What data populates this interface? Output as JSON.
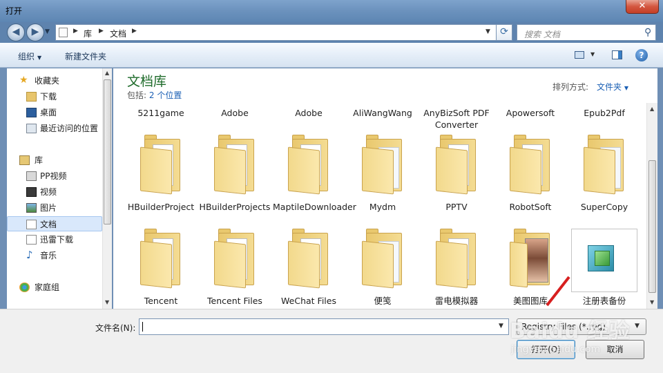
{
  "window": {
    "title": "打开",
    "close_label": "✕"
  },
  "nav": {
    "back_glyph": "◀",
    "forward_glyph": "▶",
    "breadcrumb": [
      "库",
      "文档"
    ],
    "search_placeholder": "搜索 文档",
    "refresh_glyph": "⟳"
  },
  "toolbar": {
    "organize_label": "组织",
    "new_folder_label": "新建文件夹",
    "help_glyph": "?"
  },
  "sidebar": {
    "items": [
      {
        "label": "收藏夹",
        "icon": "star-icon"
      },
      {
        "label": "下载",
        "icon": "download-folder-icon"
      },
      {
        "label": "桌面",
        "icon": "desktop-icon"
      },
      {
        "label": "最近访问的位置",
        "icon": "recent-places-icon"
      },
      {
        "label": "库",
        "icon": "library-icon"
      },
      {
        "label": "PP视频",
        "icon": "video-library-icon"
      },
      {
        "label": "视频",
        "icon": "video-icon"
      },
      {
        "label": "图片",
        "icon": "pictures-icon"
      },
      {
        "label": "文档",
        "icon": "documents-icon",
        "selected": true
      },
      {
        "label": "迅雷下载",
        "icon": "thunder-download-icon"
      },
      {
        "label": "音乐",
        "icon": "music-icon"
      },
      {
        "label": "家庭组",
        "icon": "homegroup-icon"
      }
    ]
  },
  "library": {
    "title": "文档库",
    "includes_label": "包括:",
    "locations_link": "2 个位置",
    "arrange_label": "排列方式:",
    "arrange_value": "文件夹"
  },
  "files": {
    "top_row": [
      "5211game",
      "Adobe",
      "Adobe",
      "AliWangWang",
      "AnyBizSoft PDF Converter",
      "Apowersoft",
      "Epub2Pdf"
    ],
    "row2": [
      "HBuilderProject",
      "HBuilderProjects",
      "MaptileDownloader",
      "Mydm",
      "PPTV",
      "RobotSoft",
      "SuperCopy"
    ],
    "row3": [
      "Tencent",
      "Tencent Files",
      "WeChat Files",
      "便笺",
      "雷电模拟器",
      "美图图库",
      "注册表备份"
    ]
  },
  "footer": {
    "filename_label": "文件名(N):",
    "filename_value": "",
    "filetype_value": "Registry Files (*.reg)",
    "open_label": "打开(O)",
    "cancel_label": "取消"
  },
  "watermark": {
    "text": "Baidu 经验",
    "sub": "jingyan.baidu.com"
  }
}
